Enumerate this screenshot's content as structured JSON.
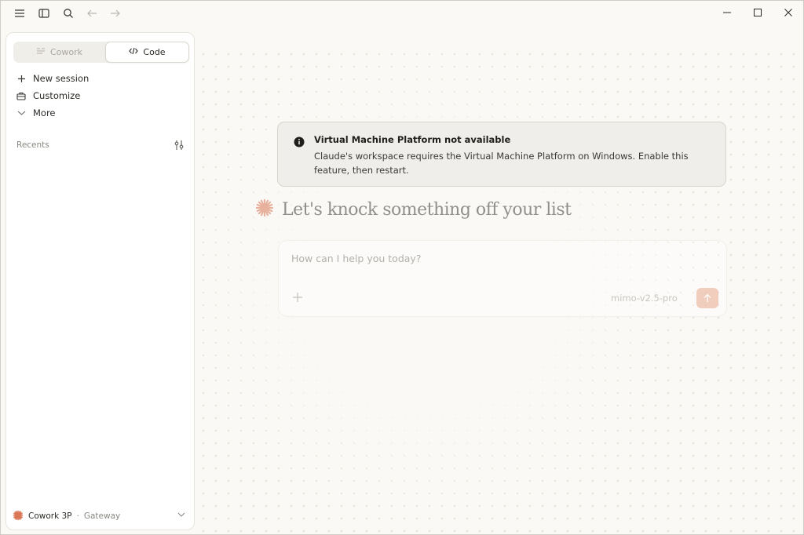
{
  "titlebar": {
    "icons": [
      "menu-icon",
      "sidebar-toggle-icon",
      "search-icon",
      "arrow-left-icon",
      "arrow-right-icon"
    ],
    "window_controls": [
      "minimize-icon",
      "maximize-icon",
      "close-icon"
    ]
  },
  "sidebar": {
    "modes": [
      {
        "label": "Cowork",
        "icon": "cowork-icon",
        "active": false
      },
      {
        "label": "Code",
        "icon": "code-icon",
        "active": true
      }
    ],
    "items": [
      {
        "label": "New session",
        "icon": "plus-icon"
      },
      {
        "label": "Customize",
        "icon": "briefcase-icon"
      },
      {
        "label": "More",
        "icon": "chevron-down-icon"
      }
    ],
    "recents_label": "Recents",
    "footer": {
      "name": "Cowork 3P",
      "separator": "·",
      "gateway": "Gateway"
    }
  },
  "banner": {
    "title": "Virtual Machine Platform not available",
    "message": "Claude's workspace requires the Virtual Machine Platform on Windows. Enable this feature, then restart."
  },
  "hero": {
    "headline": "Let's knock something off your list"
  },
  "composer": {
    "placeholder": "How can I help you today?",
    "model": "mimo-v2.5-pro"
  },
  "colors": {
    "accent": "#d97757",
    "send_button": "#efbfac",
    "background": "#faf9f5"
  }
}
